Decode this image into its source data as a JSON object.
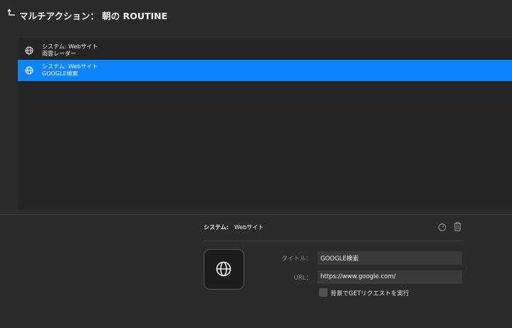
{
  "header": {
    "title": "マルチアクション： 朝の ROUTINE"
  },
  "actions": [
    {
      "type": "システム: Webサイト",
      "name": "雨雲レーダー",
      "selected": false,
      "icon": "globe-icon"
    },
    {
      "type": "システム: Webサイト",
      "name": "GOOGLE検索",
      "selected": true,
      "icon": "globe-icon"
    }
  ],
  "detail": {
    "type_label": "システム:",
    "type_value": "Webサイト",
    "title_label": "タイトル：",
    "title_value": "GOOGLE検索",
    "url_label": "URL：",
    "url_value": "https://www.google.com/",
    "background_get_label": "背景でGETリクエストを実行",
    "background_get_checked": false
  },
  "colors": {
    "background": "#2b2b2b",
    "list_background": "#252525",
    "selection": "#0a84ff",
    "input_background": "#3a3a3a"
  }
}
